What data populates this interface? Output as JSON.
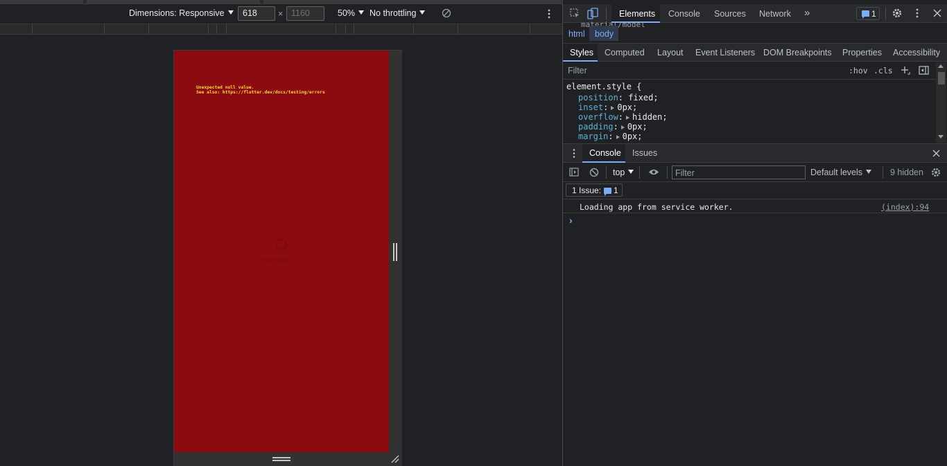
{
  "device_toolbar": {
    "dimensions_label": "Dimensions: Responsive",
    "width_value": "618",
    "height_placeholder": "1160",
    "times": "×",
    "zoom": "50%",
    "throttling": "No throttling"
  },
  "viewport": {
    "error_line1": "Unexpected null value.",
    "error_line2": "See also: https://flutter.dev/docs/testing/errors",
    "watermark_text": "SOFTSOFT"
  },
  "devtools": {
    "tabs": [
      "Elements",
      "Console",
      "Sources",
      "Network"
    ],
    "more_tabs": "»",
    "issues_count": "1",
    "breadcrumbs": [
      "html",
      "body"
    ],
    "breadcrumb_partial": "material/model",
    "subtabs": [
      "Styles",
      "Computed",
      "Layout",
      "Event Listeners",
      "DOM Breakpoints",
      "Properties",
      "Accessibility"
    ],
    "styles_filter_placeholder": "Filter",
    "hov": ":hov",
    "cls": ".cls",
    "selector": "element.style",
    "open_brace": "{",
    "properties": [
      {
        "name": "position",
        "value": "fixed;"
      },
      {
        "name": "inset",
        "value": "0px;"
      },
      {
        "name": "overflow",
        "value": "hidden;"
      },
      {
        "name": "padding",
        "value": "0px;"
      },
      {
        "name": "margin",
        "value": "0px;"
      }
    ],
    "drawer_tabs": [
      "Console",
      "Issues"
    ],
    "console_context": "top",
    "console_filter_placeholder": "Filter",
    "default_levels": "Default levels",
    "hidden_count": "9 hidden",
    "issues_label": "1 Issue:",
    "issues_badge": "1",
    "messages": [
      {
        "text": "Loading app from service worker.",
        "source": "(index):94"
      }
    ],
    "prompt": "›"
  },
  "colors": {
    "viewport_bg": "#8b0b10",
    "error_text": "#ffd83f",
    "prop_name": "#5db0d7",
    "accent": "#7cacf8"
  }
}
